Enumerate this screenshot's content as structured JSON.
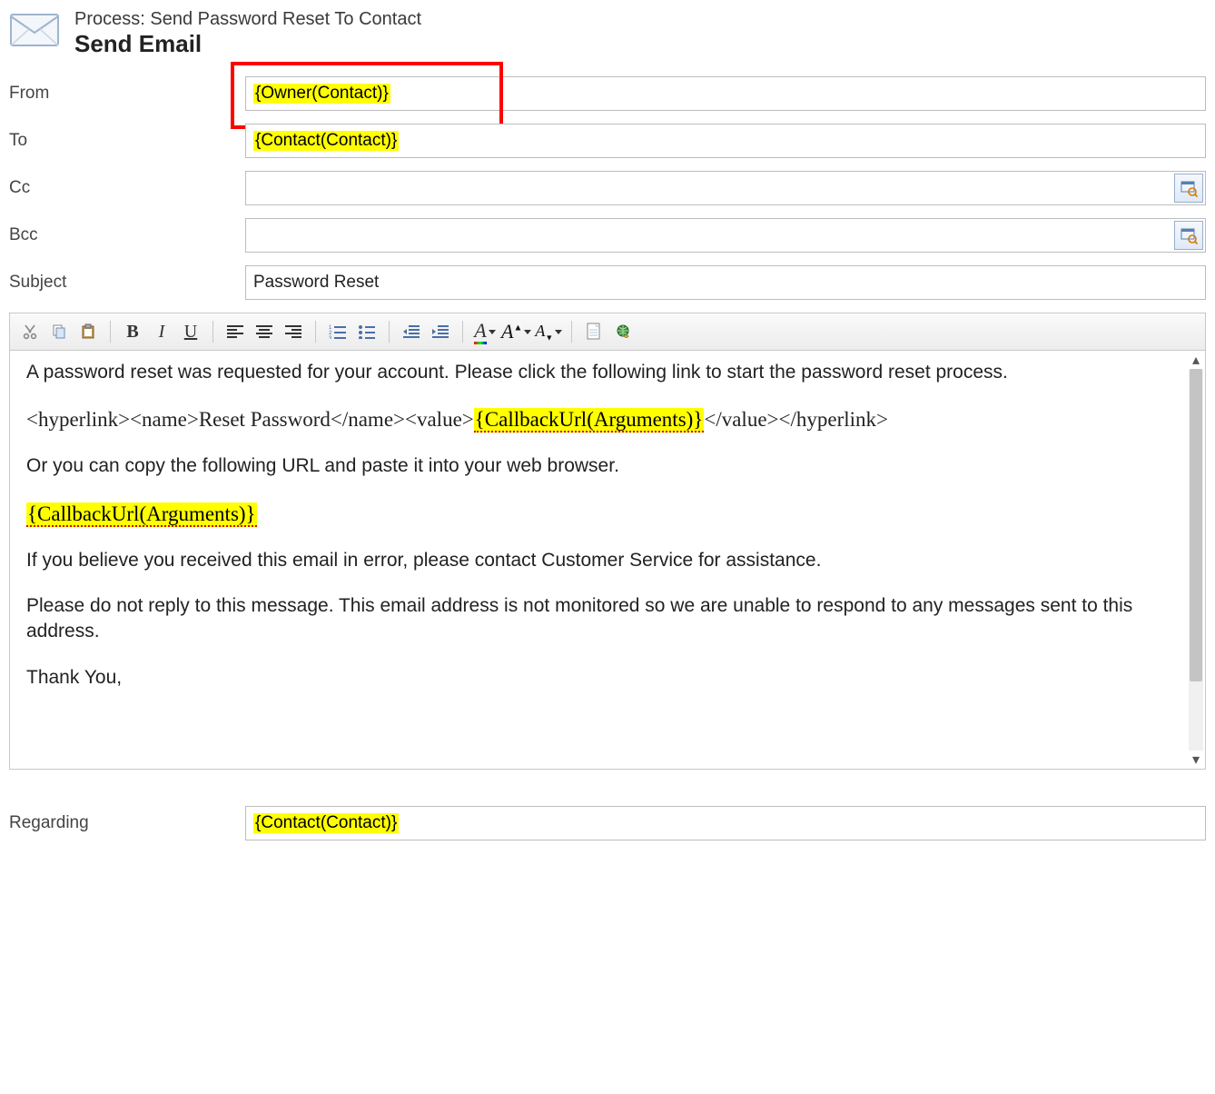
{
  "header": {
    "process_label": "Process: Send Password Reset To Contact",
    "title": "Send Email"
  },
  "fields": {
    "from": {
      "label": "From",
      "value": "{Owner(Contact)}"
    },
    "to": {
      "label": "To",
      "value": "{Contact(Contact)}"
    },
    "cc": {
      "label": "Cc",
      "value": ""
    },
    "bcc": {
      "label": "Bcc",
      "value": ""
    },
    "subject": {
      "label": "Subject",
      "value": "Password Reset"
    },
    "regarding": {
      "label": "Regarding",
      "value": "{Contact(Contact)}"
    }
  },
  "toolbar": {
    "cut": "Cut",
    "copy": "Copy",
    "paste": "Paste",
    "bold": "B",
    "italic": "I",
    "underline": "U",
    "align_left": "Align Left",
    "align_center": "Align Center",
    "align_right": "Align Right",
    "ol": "Numbered List",
    "ul": "Bulleted List",
    "outdent": "Decrease Indent",
    "indent": "Increase Indent",
    "font_color": "A",
    "font_size_up": "A",
    "font_size_down": "A",
    "insert": "Insert",
    "hyperlink": "Hyperlink"
  },
  "body": {
    "p1": "A password reset was requested for your account. Please click the following link to start the password reset process.",
    "hyperlink_open": "<hyperlink><name>Reset Password</name><value>",
    "callback_token": "{CallbackUrl(Arguments)}",
    "hyperlink_close": "</value></hyperlink>",
    "p3": "Or you can copy the following URL and paste it into your web browser.",
    "p5": "If you believe you received this email in error, please contact Customer Service for assistance.",
    "p6": "Please do not reply to this message. This email address is not monitored so we are unable to respond to any messages sent to this address.",
    "p7": "Thank You,"
  }
}
